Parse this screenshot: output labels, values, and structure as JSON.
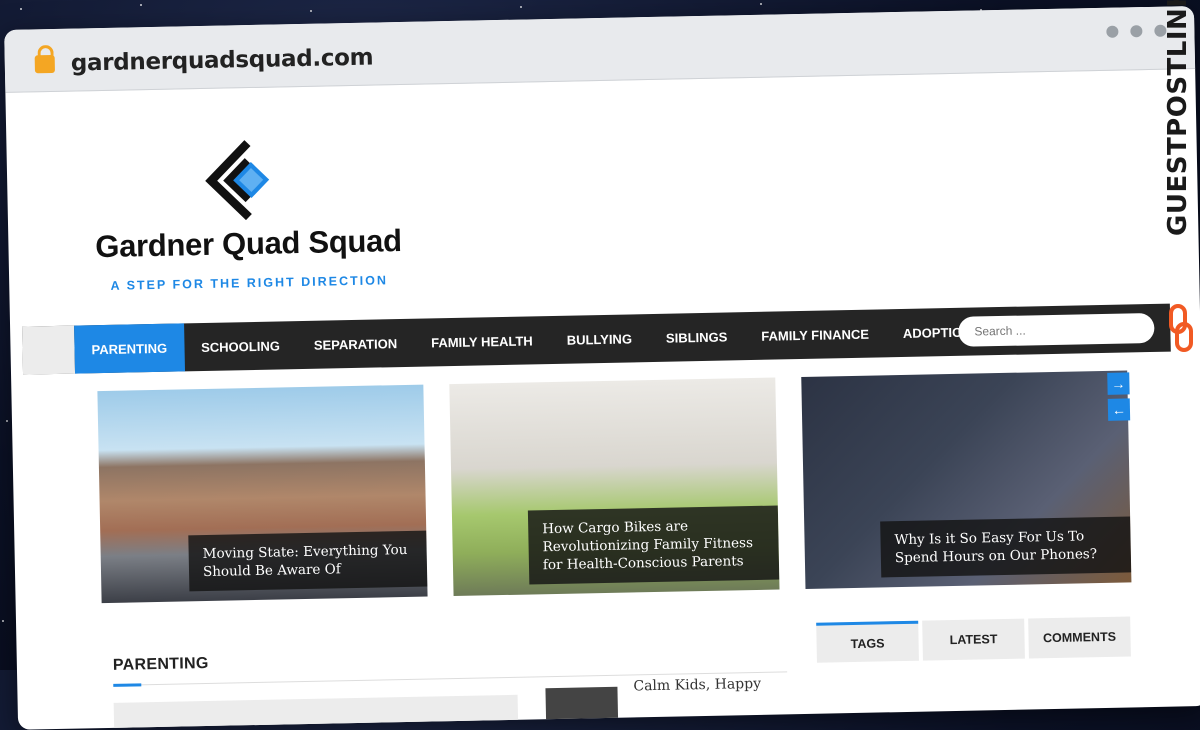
{
  "browser": {
    "url": "gardnerquadsquad.com"
  },
  "site": {
    "title": "Gardner Quad Squad",
    "tagline": "A STEP FOR THE RIGHT DIRECTION"
  },
  "nav": {
    "items": [
      "PARENTING",
      "SCHOOLING",
      "SEPARATION",
      "FAMILY HEALTH",
      "BULLYING",
      "SIBLINGS",
      "FAMILY FINANCE",
      "ADOPTION"
    ],
    "search_placeholder": "Search ..."
  },
  "featured": [
    {
      "caption": "Moving State: Everything You Should Be Aware Of"
    },
    {
      "caption": "How Cargo Bikes are Revolutionizing Family Fitness for Health-Conscious Parents"
    },
    {
      "caption": "Why Is it So Easy For Us To Spend Hours on Our Phones?"
    }
  ],
  "section": {
    "title": "PARENTING",
    "first_post_title": "Calm Kids, Happy"
  },
  "sidebar": {
    "tabs": [
      "TAGS",
      "LATEST",
      "COMMENTS"
    ]
  },
  "watermark": {
    "text": "GUESTPOSTLINKS"
  },
  "colors": {
    "accent": "#1e88e5",
    "nav_bg": "#252525",
    "brand_orange": "#f15a24"
  }
}
